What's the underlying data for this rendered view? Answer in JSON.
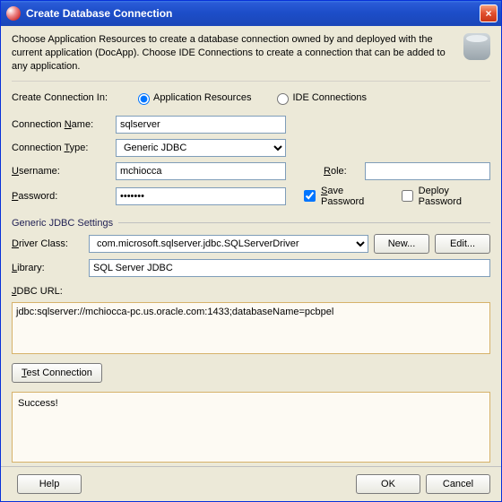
{
  "window": {
    "title": "Create Database Connection",
    "close_glyph": "×"
  },
  "description": "Choose Application Resources to create a database connection owned by and deployed with the current application (DocApp). Choose IDE Connections to create a connection that can be added to any application.",
  "create_in": {
    "label": "Create Connection In:",
    "option1": "Application Resources",
    "option2": "IDE Connections",
    "selected": "Application Resources"
  },
  "fields": {
    "connection_name_label": "Connection Name:",
    "connection_name_under": "N",
    "connection_name": "sqlserver",
    "connection_type_label": "Connection Type:",
    "connection_type_under": "T",
    "connection_type": "Generic JDBC",
    "username_label": "Username:",
    "username_under": "U",
    "username": "mchiocca",
    "role_label": "Role:",
    "role_under": "R",
    "role": "",
    "password_label": "Password:",
    "password_under": "P",
    "password": "•••••••",
    "save_pw": "Save Password",
    "save_pw_under": "S",
    "deploy_pw": "Deploy Password"
  },
  "jdbc": {
    "group": "Generic JDBC Settings",
    "driver_class_label": "Driver Class:",
    "driver_class_under": "D",
    "driver_class": "com.microsoft.sqlserver.jdbc.SQLServerDriver",
    "new_btn": "New...",
    "edit_btn": "Edit...",
    "library_label": "Library:",
    "library_under": "L",
    "library": "SQL Server JDBC",
    "url_label": "JDBC URL:",
    "url_under": "J",
    "url": "jdbc:sqlserver://mchiocca-pc.us.oracle.com:1433;databaseName=pcbpel"
  },
  "test": {
    "btn": "Test Connection",
    "btn_under": "T",
    "result": "Success!"
  },
  "footer": {
    "help": "Help",
    "ok": "OK",
    "cancel": "Cancel"
  }
}
